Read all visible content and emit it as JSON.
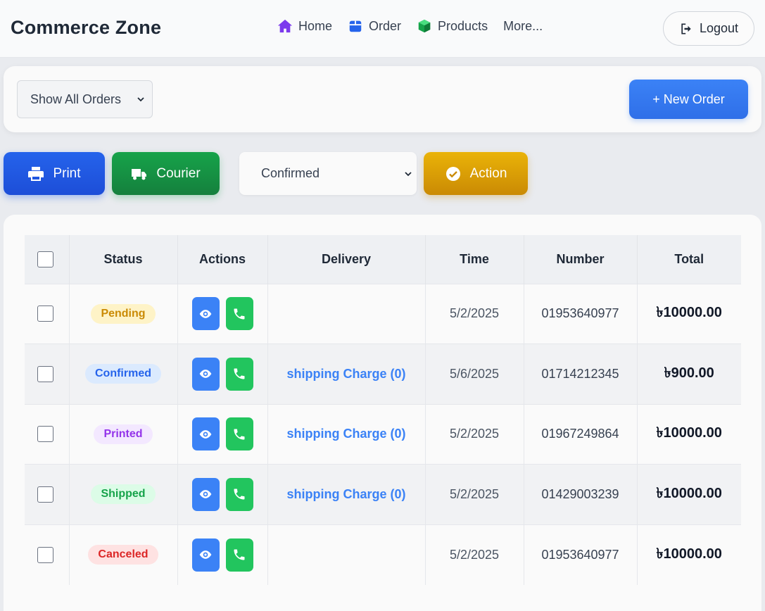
{
  "header": {
    "brand": "Commerce Zone",
    "nav": [
      {
        "label": "Home",
        "icon": "home-icon",
        "color": "#7c3aed"
      },
      {
        "label": "Order",
        "icon": "box-icon",
        "color": "#2563eb"
      },
      {
        "label": "Products",
        "icon": "cube-icon",
        "color": "#16a34a"
      },
      {
        "label": "More..."
      }
    ],
    "logout_label": "Logout"
  },
  "filter": {
    "selected": "Show All Orders",
    "new_order_label": "+ New Order"
  },
  "toolbar": {
    "print_label": "Print",
    "courier_label": "Courier",
    "status_selected": "Confirmed",
    "action_label": "Action"
  },
  "table": {
    "columns": [
      "",
      "Status",
      "Actions",
      "Delivery",
      "Time",
      "Number",
      "Total"
    ],
    "rows": [
      {
        "status": "Pending",
        "delivery": "",
        "time": "5/2/2025",
        "number": "01953640977",
        "total": "৳10000.00"
      },
      {
        "status": "Confirmed",
        "delivery": "shipping Charge (0)",
        "time": "5/6/2025",
        "number": "01714212345",
        "total": "৳900.00"
      },
      {
        "status": "Printed",
        "delivery": "shipping Charge (0)",
        "time": "5/2/2025",
        "number": "01967249864",
        "total": "৳10000.00"
      },
      {
        "status": "Shipped",
        "delivery": "shipping Charge (0)",
        "time": "5/2/2025",
        "number": "01429003239",
        "total": "৳10000.00"
      },
      {
        "status": "Canceled",
        "delivery": "",
        "time": "5/2/2025",
        "number": "01953640977",
        "total": "৳10000.00"
      }
    ]
  },
  "colors": {
    "pending_bg": "#fef3c7",
    "pending_fg": "#ca8a04",
    "confirmed_bg": "#dbeafe",
    "confirmed_fg": "#2563eb",
    "printed_bg": "#f3e8ff",
    "printed_fg": "#9333ea",
    "shipped_bg": "#dcfce7",
    "shipped_fg": "#16a34a",
    "canceled_bg": "#fee2e2",
    "canceled_fg": "#dc2626"
  }
}
